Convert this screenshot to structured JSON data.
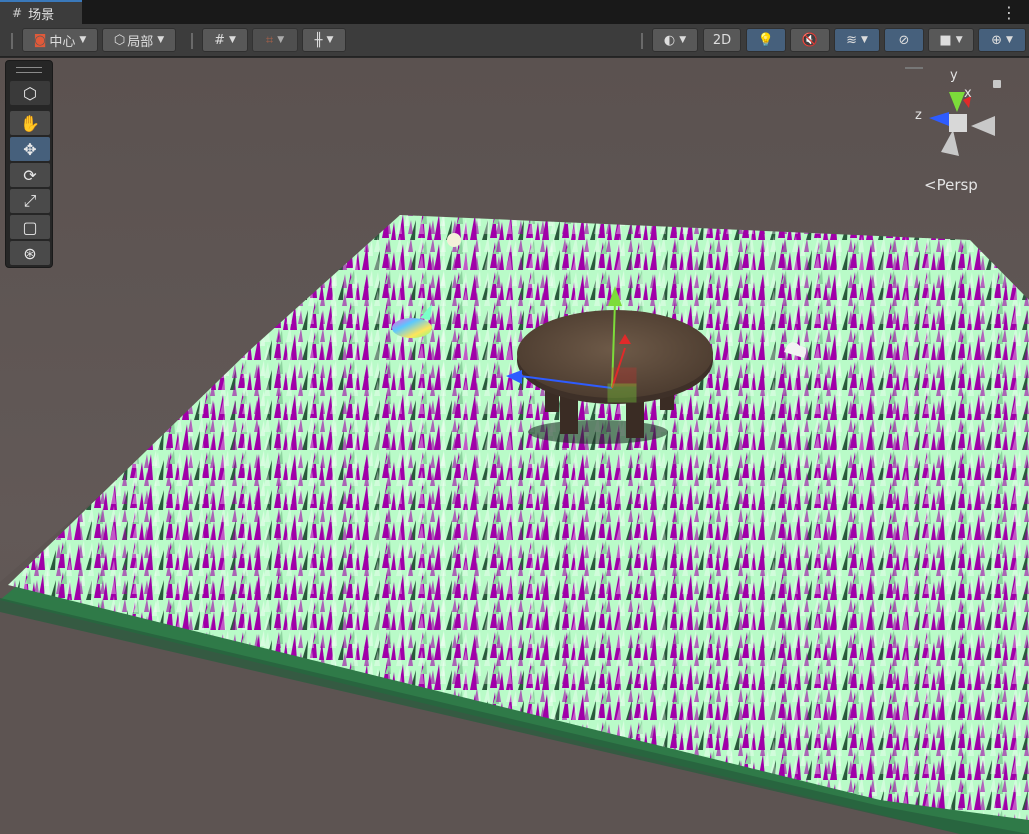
{
  "tab": {
    "icon": "scene-grid-icon",
    "title": "场景"
  },
  "toolbar": {
    "pivot_mode": "中心",
    "pivot_rotation": "局部",
    "mode_2d": "2D"
  },
  "gizmo": {
    "y": "y",
    "x": "x",
    "z": "z",
    "projection": "Persp"
  },
  "tools": [
    "view",
    "move",
    "rotate",
    "scale",
    "rect",
    "transform"
  ],
  "colors": {
    "grass_light": "#b9fbc8",
    "grass_magenta": "#a000a8",
    "ground": "#2f7a48",
    "active": "#46607c"
  }
}
